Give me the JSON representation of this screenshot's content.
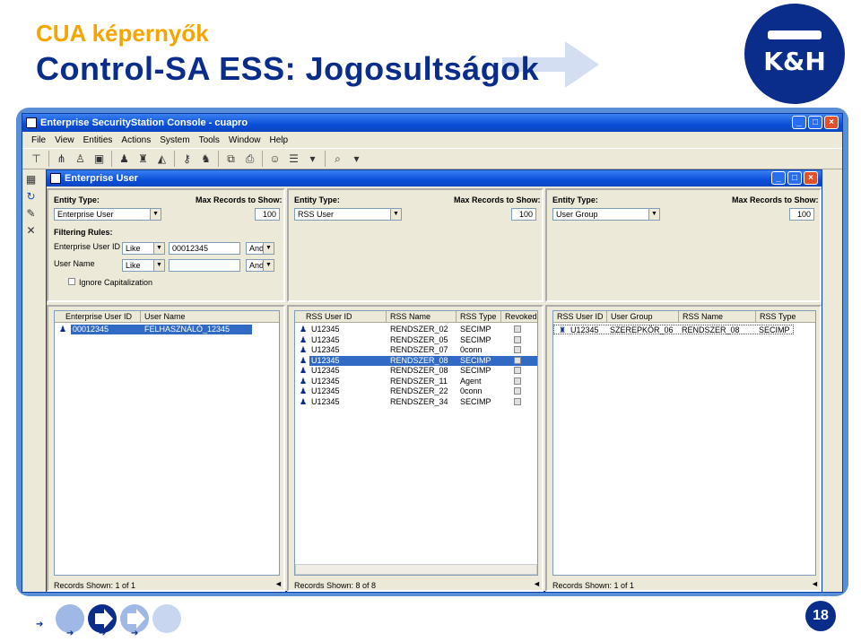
{
  "slide": {
    "title_line1": "CUA képernyők",
    "title_line2": "Control-SA ESS: Jogosultságok",
    "logo_text": "K&H",
    "page_number": "18",
    "colors": {
      "title1": "#f5a500",
      "title2": "#0a2d8c",
      "brand": "#0a2d8c"
    }
  },
  "app": {
    "title": "Enterprise SecurityStation Console - cuapro",
    "menu": [
      "File",
      "View",
      "Entities",
      "Actions",
      "System",
      "Tools",
      "Window",
      "Help"
    ],
    "inner_title": "Enterprise User"
  },
  "filters": {
    "left": {
      "entity_type_label": "Entity Type:",
      "entity_type_value": "Enterprise User",
      "max_records_label": "Max Records to Show:",
      "max_records_value": "100",
      "filtering_rules_label": "Filtering Rules:",
      "rule1_label": "Enterprise User ID",
      "rule1_op": "Like",
      "rule1_value": "00012345",
      "rule1_conj": "And",
      "rule2_label": "User Name",
      "rule2_op": "Like",
      "rule2_value": "",
      "rule2_conj": "And",
      "ignore_cap_label": "Ignore Capitalization"
    },
    "middle": {
      "entity_type_label": "Entity Type:",
      "entity_type_value": "RSS User",
      "max_records_label": "Max Records to Show:",
      "max_records_value": "100"
    },
    "right": {
      "entity_type_label": "Entity Type:",
      "entity_type_value": "User Group",
      "max_records_label": "Max Records to Show:",
      "max_records_value": "100"
    }
  },
  "lists": {
    "left": {
      "headers": [
        "Enterprise User ID",
        "User Name"
      ],
      "rows": [
        [
          "00012345",
          "FELHASZNÁLÓ_12345"
        ]
      ],
      "status": "Records Shown:  1 of 1"
    },
    "middle": {
      "headers": [
        "RSS User ID",
        "RSS Name",
        "RSS Type",
        "Revoked"
      ],
      "rows": [
        [
          "U12345",
          "RENDSZER_02",
          "SECIMP"
        ],
        [
          "U12345",
          "RENDSZER_05",
          "SECIMP"
        ],
        [
          "U12345",
          "RENDSZER_07",
          "0conn"
        ],
        [
          "U12345",
          "RENDSZER_08",
          "SECIMP"
        ],
        [
          "U12345",
          "RENDSZER_08",
          "SECIMP"
        ],
        [
          "U12345",
          "RENDSZER_11",
          "Agent"
        ],
        [
          "U12345",
          "RENDSZER_22",
          "0conn"
        ],
        [
          "U12345",
          "RENDSZER_34",
          "SECIMP"
        ]
      ],
      "selected_row": 3,
      "status": "Records Shown:  8 of 8"
    },
    "right": {
      "headers": [
        "RSS User ID",
        "User Group",
        "RSS Name",
        "RSS Type"
      ],
      "rows": [
        [
          "U12345",
          "SZEREPKÖR_06",
          "RENDSZER_08",
          "SECIMP"
        ]
      ],
      "status": "Records Shown:  1 of 1"
    }
  }
}
